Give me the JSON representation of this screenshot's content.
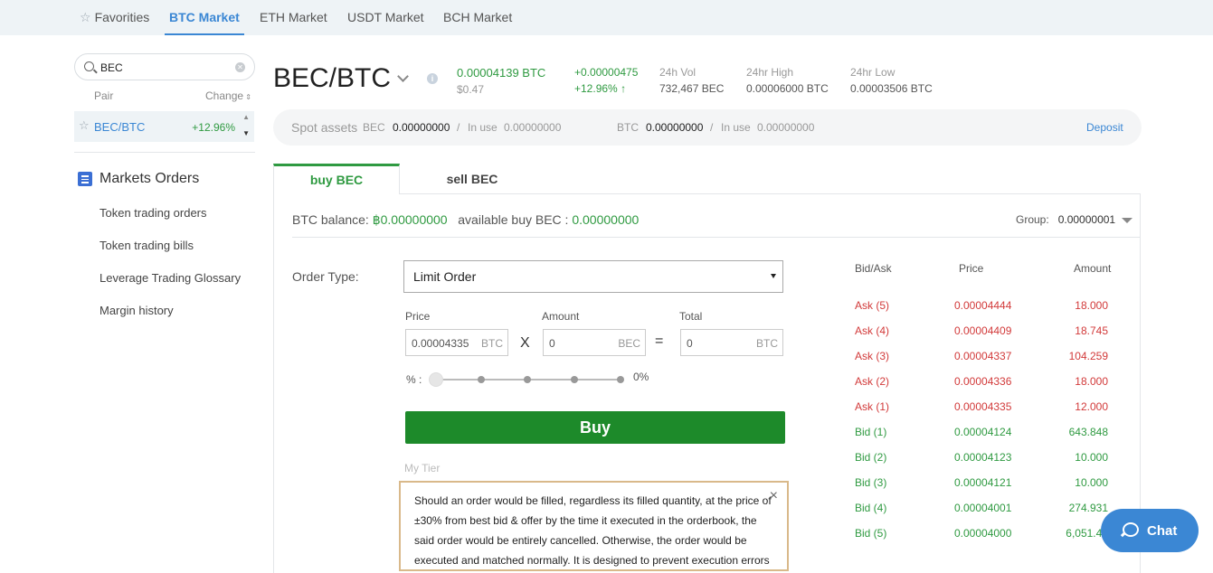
{
  "market_tabs": [
    "Favorities",
    "BTC Market",
    "ETH Market",
    "USDT Market",
    "BCH Market"
  ],
  "search": {
    "value": "BEC"
  },
  "pair_list": {
    "col_pair": "Pair",
    "col_change": "Change",
    "rows": [
      {
        "pair": "BEC/BTC",
        "change": "+12.96%"
      }
    ]
  },
  "orders_menu": {
    "title": "Markets Orders",
    "items": [
      "Token trading orders",
      "Token trading bills",
      "Leverage Trading Glossary",
      "Margin history"
    ]
  },
  "header": {
    "pair": "BEC/BTC",
    "info_icon": "i",
    "price_btc": "0.00004139 BTC",
    "price_usd": "$0.47",
    "change_abs": "+0.00000475",
    "change_pct": "+12.96%",
    "change_arrow": "↑",
    "vol_label": "24h Vol",
    "vol_value": "732,467 BEC",
    "high_label": "24hr High",
    "high_value": "0.00006000 BTC",
    "low_label": "24hr Low",
    "low_value": "0.00003506 BTC"
  },
  "spot_assets": {
    "label": "Spot assets",
    "bec_label": "BEC",
    "bec_value": "0.00000000",
    "sep": "/",
    "inuse_label": "In use",
    "bec_inuse": "0.00000000",
    "btc_label": "BTC",
    "btc_value": "0.00000000",
    "btc_inuse": "0.00000000",
    "deposit": "Deposit"
  },
  "trade_tabs": {
    "buy": "buy BEC",
    "sell": "sell BEC"
  },
  "balance": {
    "btc_label": "BTC balance:",
    "btc_value": "฿0.00000000",
    "avail_label": "available buy BEC :",
    "avail_value": "0.00000000"
  },
  "group": {
    "label": "Group:",
    "value": "0.00000001"
  },
  "order_form": {
    "type_label": "Order Type:",
    "type_value": "Limit Order",
    "price_label": "Price",
    "price_value": "0.00004335",
    "price_unit": "BTC",
    "times": "X",
    "amount_label": "Amount",
    "amount_value": "0",
    "amount_unit": "BEC",
    "equals": "=",
    "total_label": "Total",
    "total_value": "0",
    "total_unit": "BTC",
    "percent_label": "% :",
    "percent_value": "0%",
    "buy_button": "Buy",
    "tier_label": "My Tier"
  },
  "notice": {
    "close": "×",
    "text": "Should an order would be filled, regardless its filled quantity, at the price of ±30% from best bid & offer by the time it executed in the orderbook, the said order would be entirely cancelled. Otherwise, the order would be executed and matched normally. It is designed to prevent execution errors"
  },
  "order_book": {
    "headers": [
      "Bid/Ask",
      "Price",
      "Amount"
    ],
    "rows": [
      {
        "side": "Ask (5)",
        "price": "0.00004444",
        "amount": "18.000"
      },
      {
        "side": "Ask (4)",
        "price": "0.00004409",
        "amount": "18.745"
      },
      {
        "side": "Ask (3)",
        "price": "0.00004337",
        "amount": "104.259"
      },
      {
        "side": "Ask (2)",
        "price": "0.00004336",
        "amount": "18.000"
      },
      {
        "side": "Ask (1)",
        "price": "0.00004335",
        "amount": "12.000"
      },
      {
        "side": "Bid (1)",
        "price": "0.00004124",
        "amount": "643.848"
      },
      {
        "side": "Bid (2)",
        "price": "0.00004123",
        "amount": "10.000"
      },
      {
        "side": "Bid (3)",
        "price": "0.00004121",
        "amount": "10.000"
      },
      {
        "side": "Bid (4)",
        "price": "0.00004001",
        "amount": "274.931"
      },
      {
        "side": "Bid (5)",
        "price": "0.00004000",
        "amount": "6,051.45"
      }
    ],
    "ask_color": "#d23a3a",
    "bid_color": "#2f9a41"
  },
  "chat": {
    "label": "Chat"
  },
  "colors": {
    "accent": "#3b87d4",
    "buy_green": "#1d8a2a"
  }
}
